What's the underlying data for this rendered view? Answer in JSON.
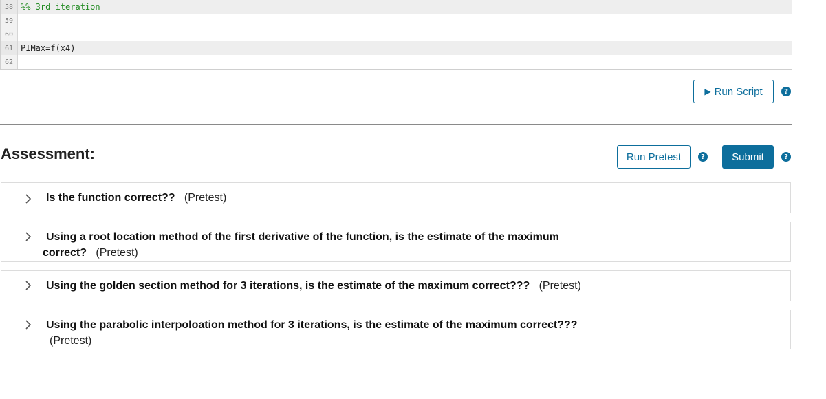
{
  "editor": {
    "lines": [
      {
        "num": "58",
        "code": "%% 3rd iteration",
        "comment": true,
        "highlight": true
      },
      {
        "num": "59",
        "code": "",
        "comment": false,
        "highlight": false
      },
      {
        "num": "60",
        "code": "",
        "comment": false,
        "highlight": false
      },
      {
        "num": "61",
        "code": "PIMax=f(x4)",
        "comment": false,
        "highlight": true
      },
      {
        "num": "62",
        "code": "",
        "comment": false,
        "highlight": false
      }
    ]
  },
  "toolbar": {
    "run_script_label": "Run Script",
    "help_glyph": "?"
  },
  "assessment": {
    "title": "Assessment:",
    "run_pretest_label": "Run Pretest",
    "submit_label": "Submit",
    "items": [
      {
        "question": "Is the function correct??",
        "tag": "(Pretest)"
      },
      {
        "question_line1": "Using a root location method of the first derivative of the function, is the estimate of the maximum",
        "question_line2": "correct?",
        "tag": "(Pretest)"
      },
      {
        "question": "Using the golden section method for 3 iterations, is the estimate of the maximum correct???",
        "tag": "(Pretest)"
      },
      {
        "question": "Using the parabolic interpoloation method for 3 iterations, is the estimate of the maximum correct???",
        "tag": "(Pretest)"
      }
    ]
  },
  "icons": {
    "play": "play-icon",
    "help": "help-icon",
    "chevron": "chevron-right-icon"
  },
  "colors": {
    "accent": "#0d6e9c",
    "comment": "#228b22"
  }
}
